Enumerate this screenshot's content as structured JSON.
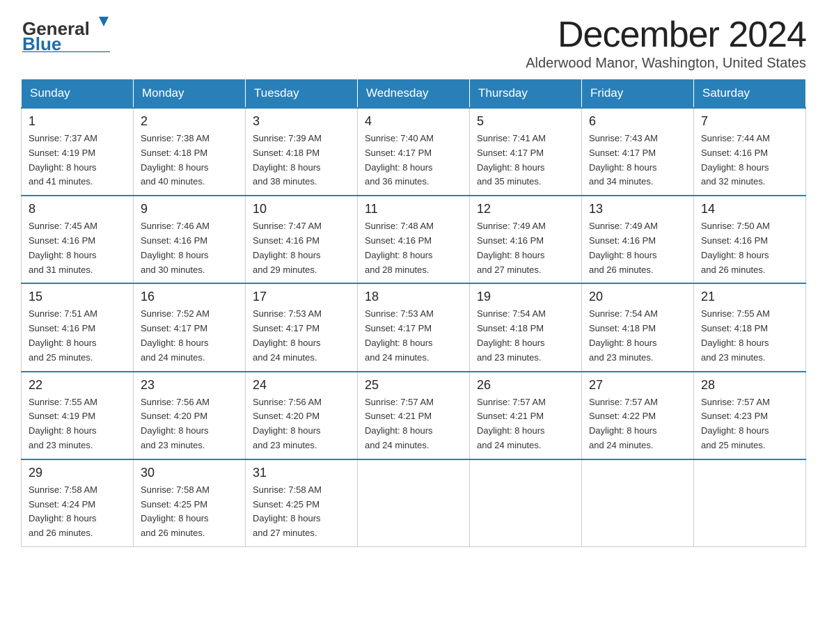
{
  "logo": {
    "general": "General",
    "blue": "Blue"
  },
  "header": {
    "title": "December 2024",
    "subtitle": "Alderwood Manor, Washington, United States"
  },
  "weekdays": [
    "Sunday",
    "Monday",
    "Tuesday",
    "Wednesday",
    "Thursday",
    "Friday",
    "Saturday"
  ],
  "weeks": [
    [
      {
        "day": "1",
        "sunrise": "7:37 AM",
        "sunset": "4:19 PM",
        "daylight": "8 hours and 41 minutes."
      },
      {
        "day": "2",
        "sunrise": "7:38 AM",
        "sunset": "4:18 PM",
        "daylight": "8 hours and 40 minutes."
      },
      {
        "day": "3",
        "sunrise": "7:39 AM",
        "sunset": "4:18 PM",
        "daylight": "8 hours and 38 minutes."
      },
      {
        "day": "4",
        "sunrise": "7:40 AM",
        "sunset": "4:17 PM",
        "daylight": "8 hours and 36 minutes."
      },
      {
        "day": "5",
        "sunrise": "7:41 AM",
        "sunset": "4:17 PM",
        "daylight": "8 hours and 35 minutes."
      },
      {
        "day": "6",
        "sunrise": "7:43 AM",
        "sunset": "4:17 PM",
        "daylight": "8 hours and 34 minutes."
      },
      {
        "day": "7",
        "sunrise": "7:44 AM",
        "sunset": "4:16 PM",
        "daylight": "8 hours and 32 minutes."
      }
    ],
    [
      {
        "day": "8",
        "sunrise": "7:45 AM",
        "sunset": "4:16 PM",
        "daylight": "8 hours and 31 minutes."
      },
      {
        "day": "9",
        "sunrise": "7:46 AM",
        "sunset": "4:16 PM",
        "daylight": "8 hours and 30 minutes."
      },
      {
        "day": "10",
        "sunrise": "7:47 AM",
        "sunset": "4:16 PM",
        "daylight": "8 hours and 29 minutes."
      },
      {
        "day": "11",
        "sunrise": "7:48 AM",
        "sunset": "4:16 PM",
        "daylight": "8 hours and 28 minutes."
      },
      {
        "day": "12",
        "sunrise": "7:49 AM",
        "sunset": "4:16 PM",
        "daylight": "8 hours and 27 minutes."
      },
      {
        "day": "13",
        "sunrise": "7:49 AM",
        "sunset": "4:16 PM",
        "daylight": "8 hours and 26 minutes."
      },
      {
        "day": "14",
        "sunrise": "7:50 AM",
        "sunset": "4:16 PM",
        "daylight": "8 hours and 26 minutes."
      }
    ],
    [
      {
        "day": "15",
        "sunrise": "7:51 AM",
        "sunset": "4:16 PM",
        "daylight": "8 hours and 25 minutes."
      },
      {
        "day": "16",
        "sunrise": "7:52 AM",
        "sunset": "4:17 PM",
        "daylight": "8 hours and 24 minutes."
      },
      {
        "day": "17",
        "sunrise": "7:53 AM",
        "sunset": "4:17 PM",
        "daylight": "8 hours and 24 minutes."
      },
      {
        "day": "18",
        "sunrise": "7:53 AM",
        "sunset": "4:17 PM",
        "daylight": "8 hours and 24 minutes."
      },
      {
        "day": "19",
        "sunrise": "7:54 AM",
        "sunset": "4:18 PM",
        "daylight": "8 hours and 23 minutes."
      },
      {
        "day": "20",
        "sunrise": "7:54 AM",
        "sunset": "4:18 PM",
        "daylight": "8 hours and 23 minutes."
      },
      {
        "day": "21",
        "sunrise": "7:55 AM",
        "sunset": "4:18 PM",
        "daylight": "8 hours and 23 minutes."
      }
    ],
    [
      {
        "day": "22",
        "sunrise": "7:55 AM",
        "sunset": "4:19 PM",
        "daylight": "8 hours and 23 minutes."
      },
      {
        "day": "23",
        "sunrise": "7:56 AM",
        "sunset": "4:20 PM",
        "daylight": "8 hours and 23 minutes."
      },
      {
        "day": "24",
        "sunrise": "7:56 AM",
        "sunset": "4:20 PM",
        "daylight": "8 hours and 23 minutes."
      },
      {
        "day": "25",
        "sunrise": "7:57 AM",
        "sunset": "4:21 PM",
        "daylight": "8 hours and 24 minutes."
      },
      {
        "day": "26",
        "sunrise": "7:57 AM",
        "sunset": "4:21 PM",
        "daylight": "8 hours and 24 minutes."
      },
      {
        "day": "27",
        "sunrise": "7:57 AM",
        "sunset": "4:22 PM",
        "daylight": "8 hours and 24 minutes."
      },
      {
        "day": "28",
        "sunrise": "7:57 AM",
        "sunset": "4:23 PM",
        "daylight": "8 hours and 25 minutes."
      }
    ],
    [
      {
        "day": "29",
        "sunrise": "7:58 AM",
        "sunset": "4:24 PM",
        "daylight": "8 hours and 26 minutes."
      },
      {
        "day": "30",
        "sunrise": "7:58 AM",
        "sunset": "4:25 PM",
        "daylight": "8 hours and 26 minutes."
      },
      {
        "day": "31",
        "sunrise": "7:58 AM",
        "sunset": "4:25 PM",
        "daylight": "8 hours and 27 minutes."
      },
      null,
      null,
      null,
      null
    ]
  ],
  "labels": {
    "sunrise": "Sunrise:",
    "sunset": "Sunset:",
    "daylight": "Daylight:"
  }
}
